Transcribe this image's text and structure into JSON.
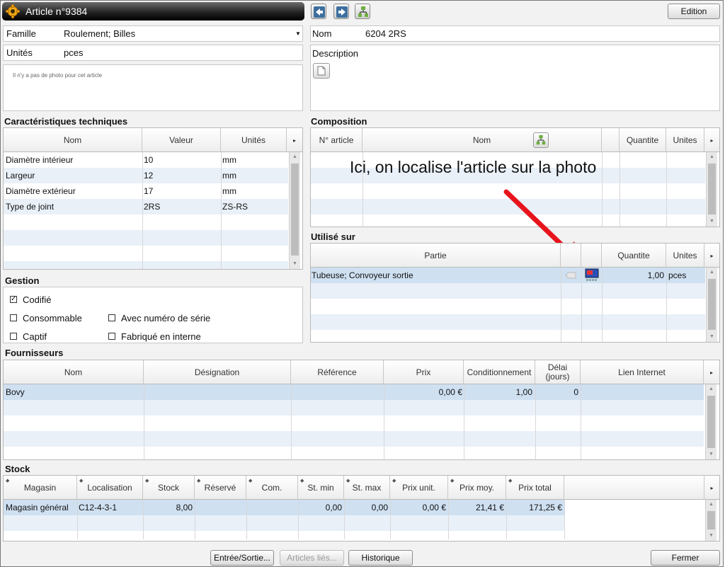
{
  "window": {
    "title": "Article n°9384"
  },
  "toolbar": {
    "edition_label": "Edition"
  },
  "article": {
    "famille_label": "Famille",
    "famille_value": "Roulement; Billes",
    "unites_label": "Unités",
    "unites_value": "pces",
    "nom_label": "Nom",
    "nom_value": "6204 2RS",
    "description_label": "Description",
    "photo_note": "Il n'y a pas de photo pour cet article"
  },
  "caracteristiques": {
    "title": "Caractéristiques techniques",
    "headers": [
      "Nom",
      "Valeur",
      "Unités"
    ],
    "rows": [
      [
        "Diamètre intérieur",
        "10",
        "mm"
      ],
      [
        "Largeur",
        "12",
        "mm"
      ],
      [
        "Diamètre extérieur",
        "17",
        "mm"
      ],
      [
        "Type de joint",
        "2RS",
        "ZS-RS"
      ]
    ]
  },
  "composition": {
    "title": "Composition",
    "headers": [
      "N° article",
      "Nom",
      "",
      "Quantite",
      "Unites"
    ]
  },
  "annotation": {
    "text": "Ici, on localise l'article sur la photo"
  },
  "utilise_sur": {
    "title": "Utilisé sur",
    "headers": [
      "Partie",
      "",
      "",
      "Quantite",
      "Unites"
    ],
    "rows": [
      [
        "Tubeuse; Convoyeur sortie",
        "",
        "",
        "1,00",
        "pces"
      ]
    ]
  },
  "gestion": {
    "title": "Gestion",
    "codifie": "Codifié",
    "consommable": "Consommable",
    "captif": "Captif",
    "numero_serie": "Avec numéro de série",
    "fabrique": "Fabriqué en interne",
    "check_mark": "✓"
  },
  "fournisseurs": {
    "title": "Fournisseurs",
    "headers": [
      "Nom",
      "Désignation",
      "Référence",
      "Prix",
      "Conditionnement",
      "Délai (jours)",
      "Lien Internet"
    ],
    "rows": [
      [
        "Bovy",
        "",
        "",
        "0,00 €",
        "1,00",
        "0",
        ""
      ]
    ]
  },
  "stock": {
    "title": "Stock",
    "headers": [
      "Magasin",
      "Localisation",
      "Stock",
      "Réservé",
      "Com.",
      "St. min",
      "St. max",
      "Prix unit.",
      "Prix moy.",
      "Prix total"
    ],
    "rows": [
      [
        "Magasin général",
        "C12-4-3-1",
        "8,00",
        "",
        "",
        "0,00",
        "0,00",
        "0,00 €",
        "21,41 €",
        "171,25 €"
      ]
    ]
  },
  "footer": {
    "entree_sortie": "Entrée/Sortie...",
    "articles_lies": "Articles liés...",
    "historique": "Historique",
    "fermer": "Fermer"
  },
  "colors": {
    "accent_arrow": "#e8141c",
    "selection": "#cfe0f1"
  }
}
